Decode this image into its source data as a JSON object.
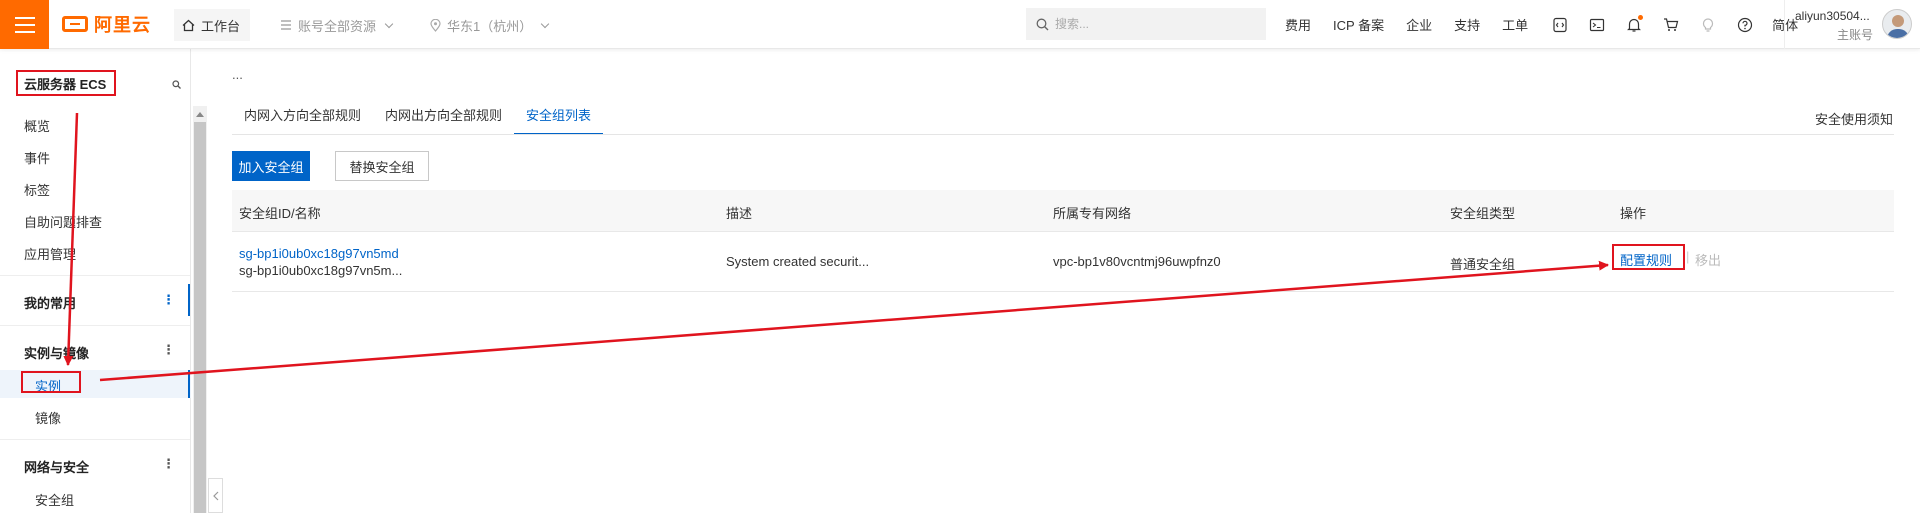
{
  "topbar": {
    "workbench": "工作台",
    "resources": "账号全部资源",
    "region": "华东1（杭州）",
    "search_placeholder": "搜索...",
    "links": [
      "费用",
      "ICP 备案",
      "企业",
      "支持",
      "工单"
    ],
    "lang": "简体",
    "account_name": "aliyun30504...",
    "account_role": "主账号"
  },
  "sidebar": {
    "title": "云服务器 ECS",
    "items": [
      "概览",
      "事件",
      "标签",
      "自助问题排查",
      "应用管理"
    ],
    "groups": {
      "favorites": "我的常用",
      "instances_images": "实例与镜像",
      "instance": "实例",
      "image": "镜像",
      "network_security": "网络与安全",
      "security_group": "安全组"
    },
    "more_glyph": "⋮"
  },
  "main": {
    "breadcrumb": "...",
    "tabs": [
      "内网入方向全部规则",
      "内网出方向全部规则",
      "安全组列表"
    ],
    "active_tab": 2,
    "notice": "安全使用须知",
    "buttons": {
      "add": "加入安全组",
      "replace": "替换安全组"
    },
    "table": {
      "headers": [
        "安全组ID/名称",
        "描述",
        "所属专有网络",
        "安全组类型",
        "操作"
      ],
      "rows": [
        {
          "id": "sg-bp1i0ub0xc18g97vn5md",
          "name": "sg-bp1i0ub0xc18g97vn5m...",
          "description": "System created securit...",
          "vpc": "vpc-bp1v80vcntmj96uwpfnz0",
          "type": "普通安全组",
          "op_config": "配置规则",
          "op_remove": "移出"
        }
      ]
    }
  },
  "colors": {
    "brand": "#ff6a00",
    "primary": "#0064c8",
    "annotation": "#e0141e"
  }
}
